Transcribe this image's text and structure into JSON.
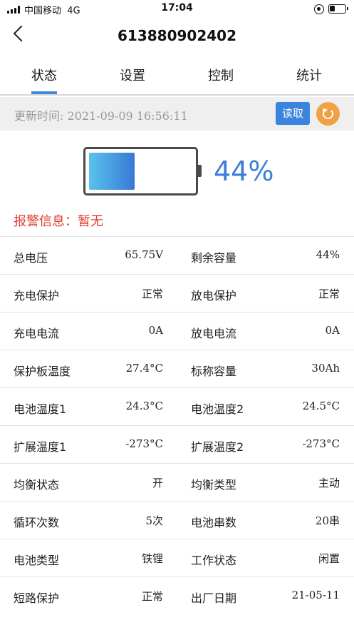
{
  "status_bar": {
    "carrier": "中国移动",
    "network": "4G",
    "time": "17:04",
    "orientation_lock_icon": "orientation-lock-icon",
    "battery_icon": "battery-icon"
  },
  "nav": {
    "title": "613880902402",
    "back_icon": "chevron-left-icon"
  },
  "tabs": [
    {
      "label": "状态",
      "active": true
    },
    {
      "label": "设置",
      "active": false
    },
    {
      "label": "控制",
      "active": false
    },
    {
      "label": "统计",
      "active": false
    }
  ],
  "update": {
    "text": "更新时间: 2021-09-09 16:56:11",
    "read_label": "读取",
    "refresh_icon": "refresh-icon"
  },
  "battery": {
    "level_fraction": 0.44,
    "percent_text": "44%"
  },
  "alarm": {
    "text": "报警信息：暂无"
  },
  "rows": [
    {
      "l1": "总电压",
      "v1": "65.75V",
      "l2": "剩余容量",
      "v2": "44%"
    },
    {
      "l1": "充电保护",
      "v1": "正常",
      "l2": "放电保护",
      "v2": "正常"
    },
    {
      "l1": "充电电流",
      "v1": "0A",
      "l2": "放电电流",
      "v2": "0A"
    },
    {
      "l1": "保护板温度",
      "v1": "27.4°C",
      "l2": "标称容量",
      "v2": "30Ah"
    },
    {
      "l1": "电池温度1",
      "v1": "24.3°C",
      "l2": "电池温度2",
      "v2": "24.5°C"
    },
    {
      "l1": "扩展温度1",
      "v1": "-273°C",
      "l2": "扩展温度2",
      "v2": "-273°C"
    },
    {
      "l1": "均衡状态",
      "v1": "开",
      "l2": "均衡类型",
      "v2": "主动"
    },
    {
      "l1": "循环次数",
      "v1": "5次",
      "l2": "电池串数",
      "v2": "20串"
    },
    {
      "l1": "电池类型",
      "v1": "铁锂",
      "l2": "工作状态",
      "v2": "闲置"
    },
    {
      "l1": "短路保护",
      "v1": "正常",
      "l2": "出厂日期",
      "v2": "21-05-11"
    }
  ],
  "colors": {
    "accent": "#3a84de",
    "refresh": "#f0a146",
    "alarm": "#e03d2f",
    "percent": "#3b7fd4"
  }
}
